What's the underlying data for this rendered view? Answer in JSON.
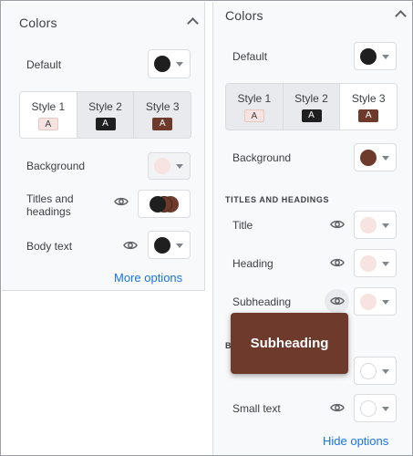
{
  "colors": {
    "dark": "#1f1f1f",
    "brown": "#6d3a2c",
    "pink_light": "#f7e3e0",
    "blank": "#ffffff",
    "link": "#1a73e8"
  },
  "left": {
    "title": "Colors",
    "default_label": "Default",
    "styles": [
      {
        "label": "Style 1",
        "chip": "A"
      },
      {
        "label": "Style 2",
        "chip": "A"
      },
      {
        "label": "Style 3",
        "chip": "A"
      }
    ],
    "active_style": "Style 1",
    "background_label": "Background",
    "titles_label_line1": "Titles and",
    "titles_label_line2": "headings",
    "body_label": "Body text",
    "more_options": "More options"
  },
  "right": {
    "title": "Colors",
    "default_label": "Default",
    "styles": [
      {
        "label": "Style 1",
        "chip": "A"
      },
      {
        "label": "Style 2",
        "chip": "A"
      },
      {
        "label": "Style 3",
        "chip": "A"
      }
    ],
    "active_style": "Style 3",
    "background_label": "Background",
    "section_heading": "TITLES AND HEADINGS",
    "rows": [
      {
        "label": "Title"
      },
      {
        "label": "Heading"
      },
      {
        "label": "Subheading"
      }
    ],
    "hidden_section_partial": "B",
    "small_text_label": "Small text",
    "hide_options": "Hide options"
  },
  "tooltip": {
    "text": "Subheading"
  },
  "icons": [
    "chevron-up-icon",
    "eye-icon",
    "caret-down-icon"
  ]
}
